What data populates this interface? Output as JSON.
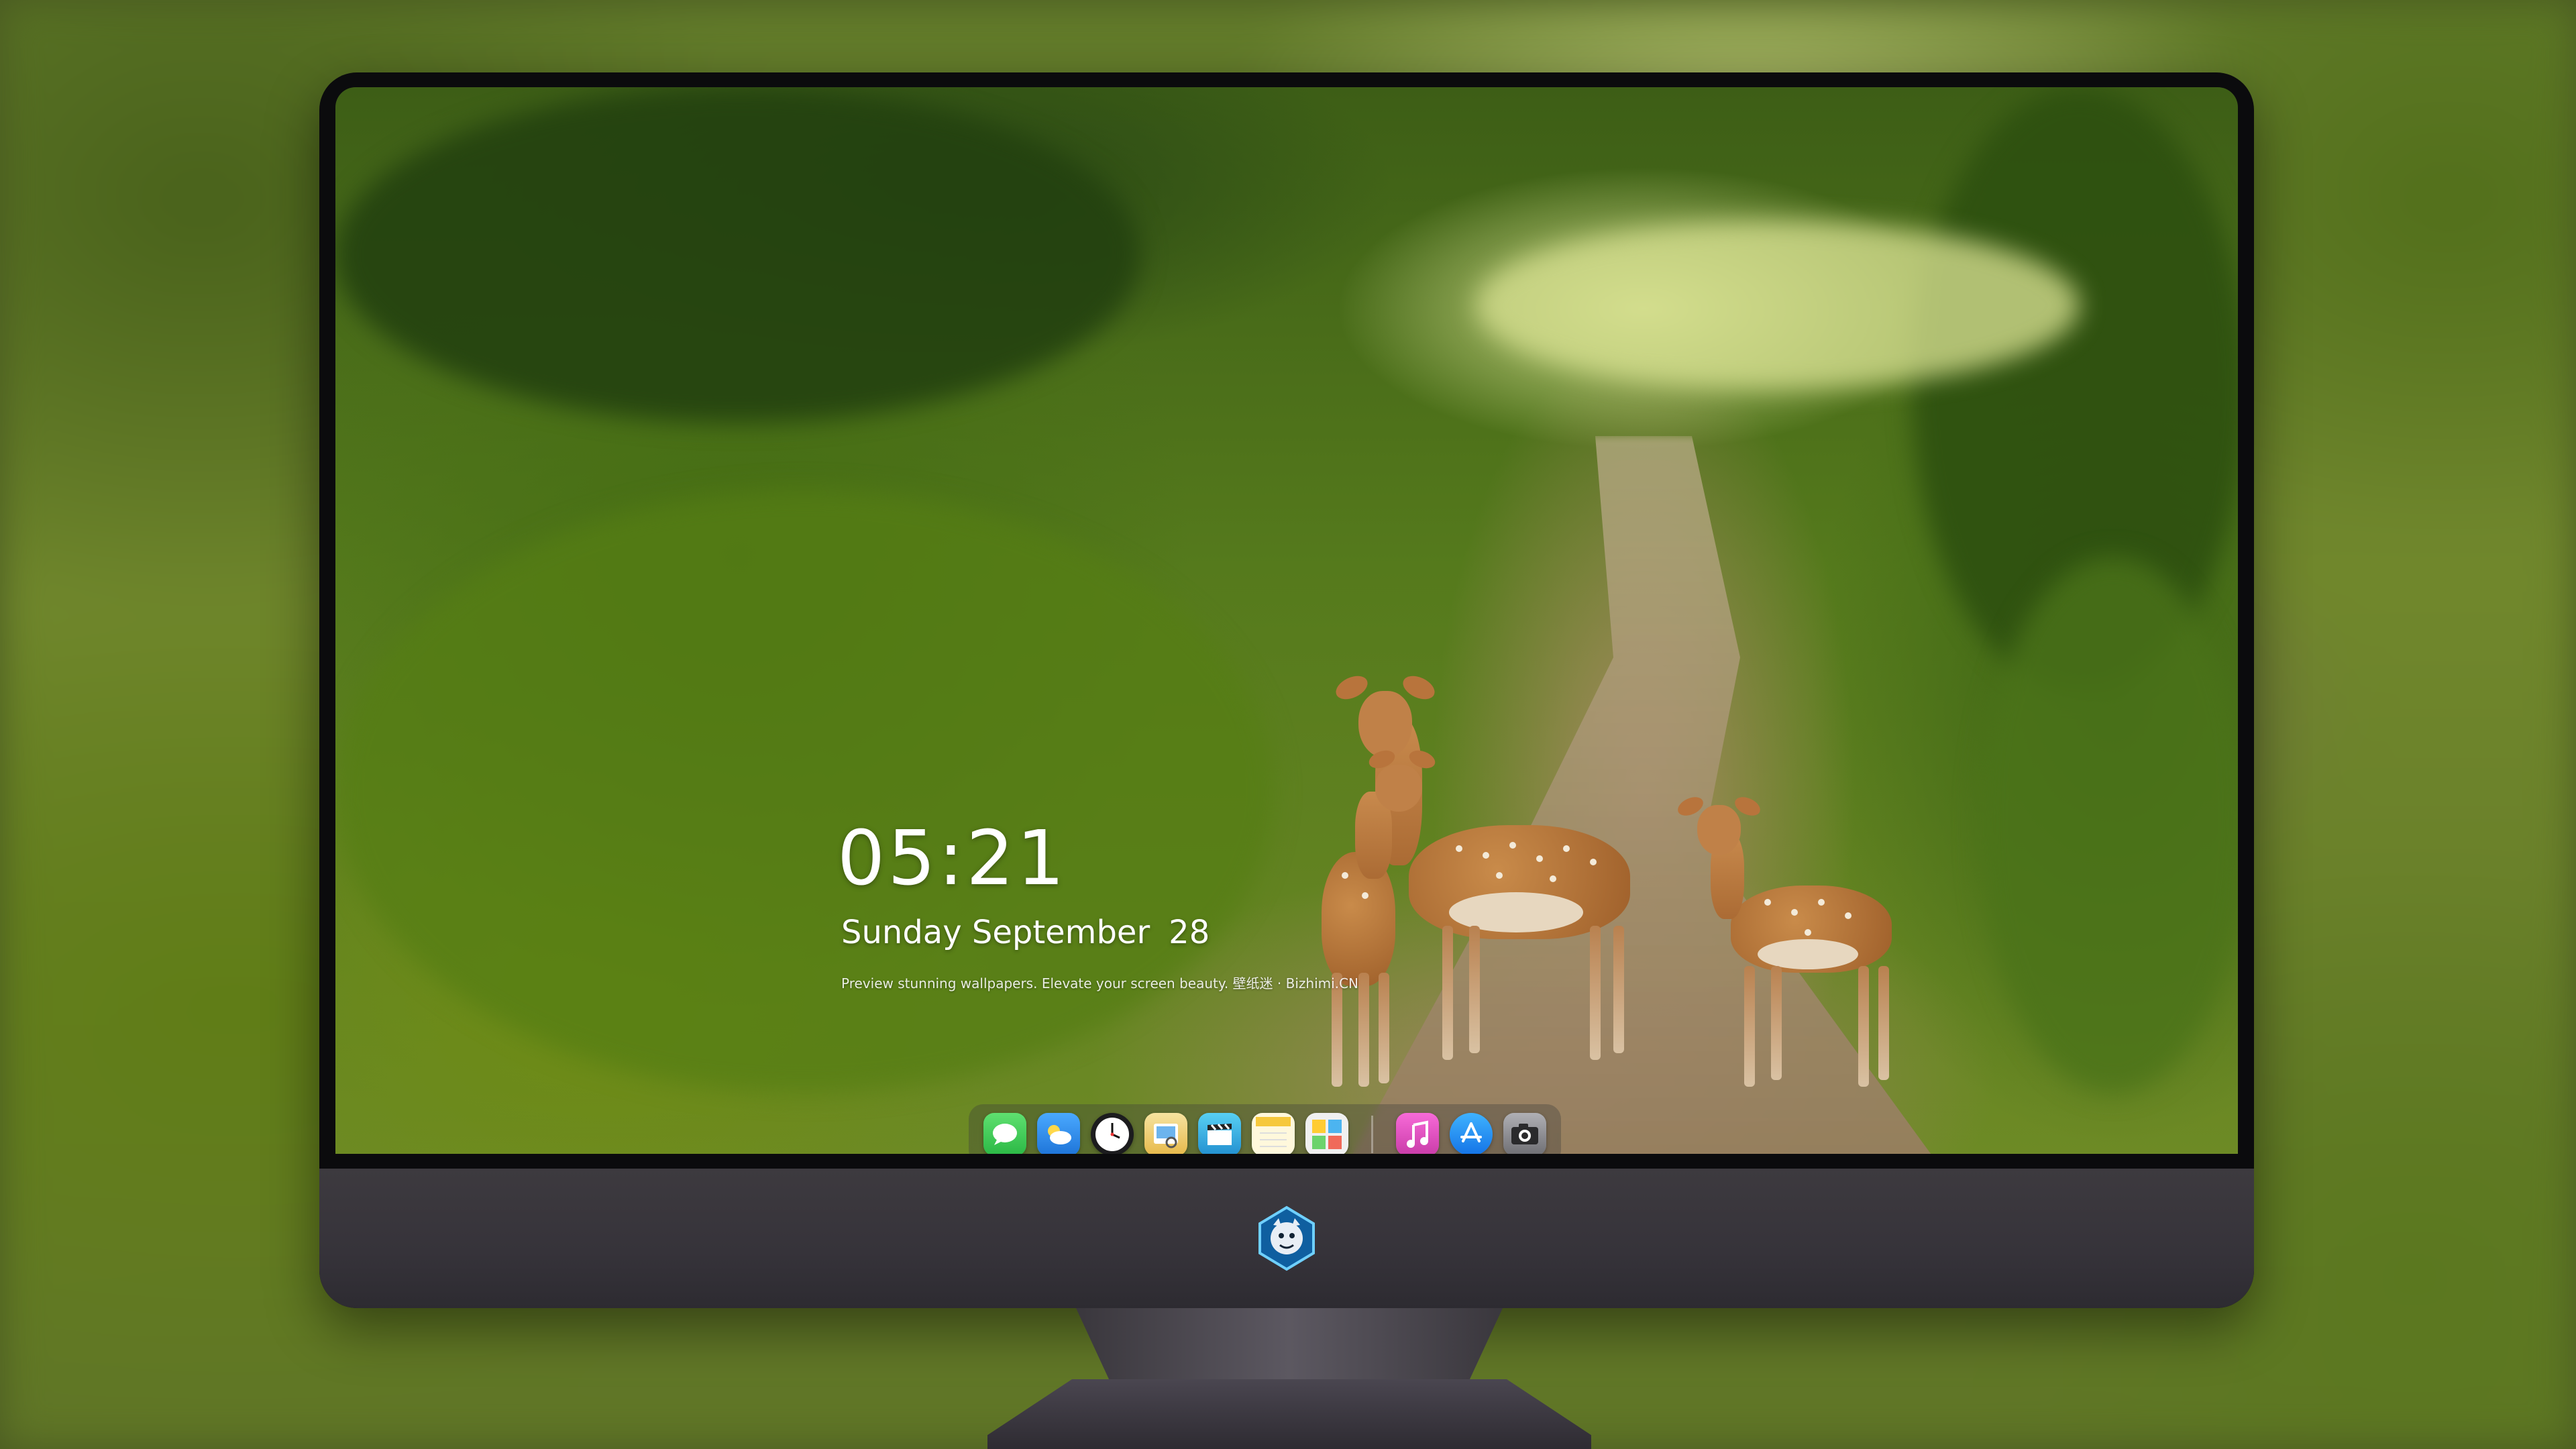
{
  "lockscreen": {
    "time": "05:21",
    "date_text": "Sunday September",
    "day_number": "28",
    "tagline": "Preview stunning wallpapers. Elevate your screen beauty. 壁纸迷 · Bizhimi.CN"
  },
  "dock": {
    "apps": [
      {
        "name": "Messages",
        "icon": "messages-icon",
        "color": "#34c759"
      },
      {
        "name": "Weather",
        "icon": "weather-icon",
        "color": "#2f8cf0"
      },
      {
        "name": "Clock",
        "icon": "clock-icon",
        "color": "#1c1c1e"
      },
      {
        "name": "Preview",
        "icon": "preview-icon",
        "color": "#f2c14e"
      },
      {
        "name": "Clips",
        "icon": "clapper-icon",
        "color": "#3ab6e6"
      },
      {
        "name": "Notes",
        "icon": "notes-icon",
        "color": "#f7d44a"
      },
      {
        "name": "Photo Booth",
        "icon": "photo-booth-icon",
        "color": "#e8e8e8"
      },
      {
        "name": "Music",
        "icon": "music-icon",
        "color": "#e94ec4"
      },
      {
        "name": "App Store",
        "icon": "app-store-icon",
        "color": "#1a8cf5"
      },
      {
        "name": "Camera",
        "icon": "camera-icon",
        "color": "#8e8e93"
      }
    ]
  },
  "colors": {
    "bezel": "#0b0b0d",
    "chin": "#3d3a3f",
    "text": "#ffffff"
  }
}
